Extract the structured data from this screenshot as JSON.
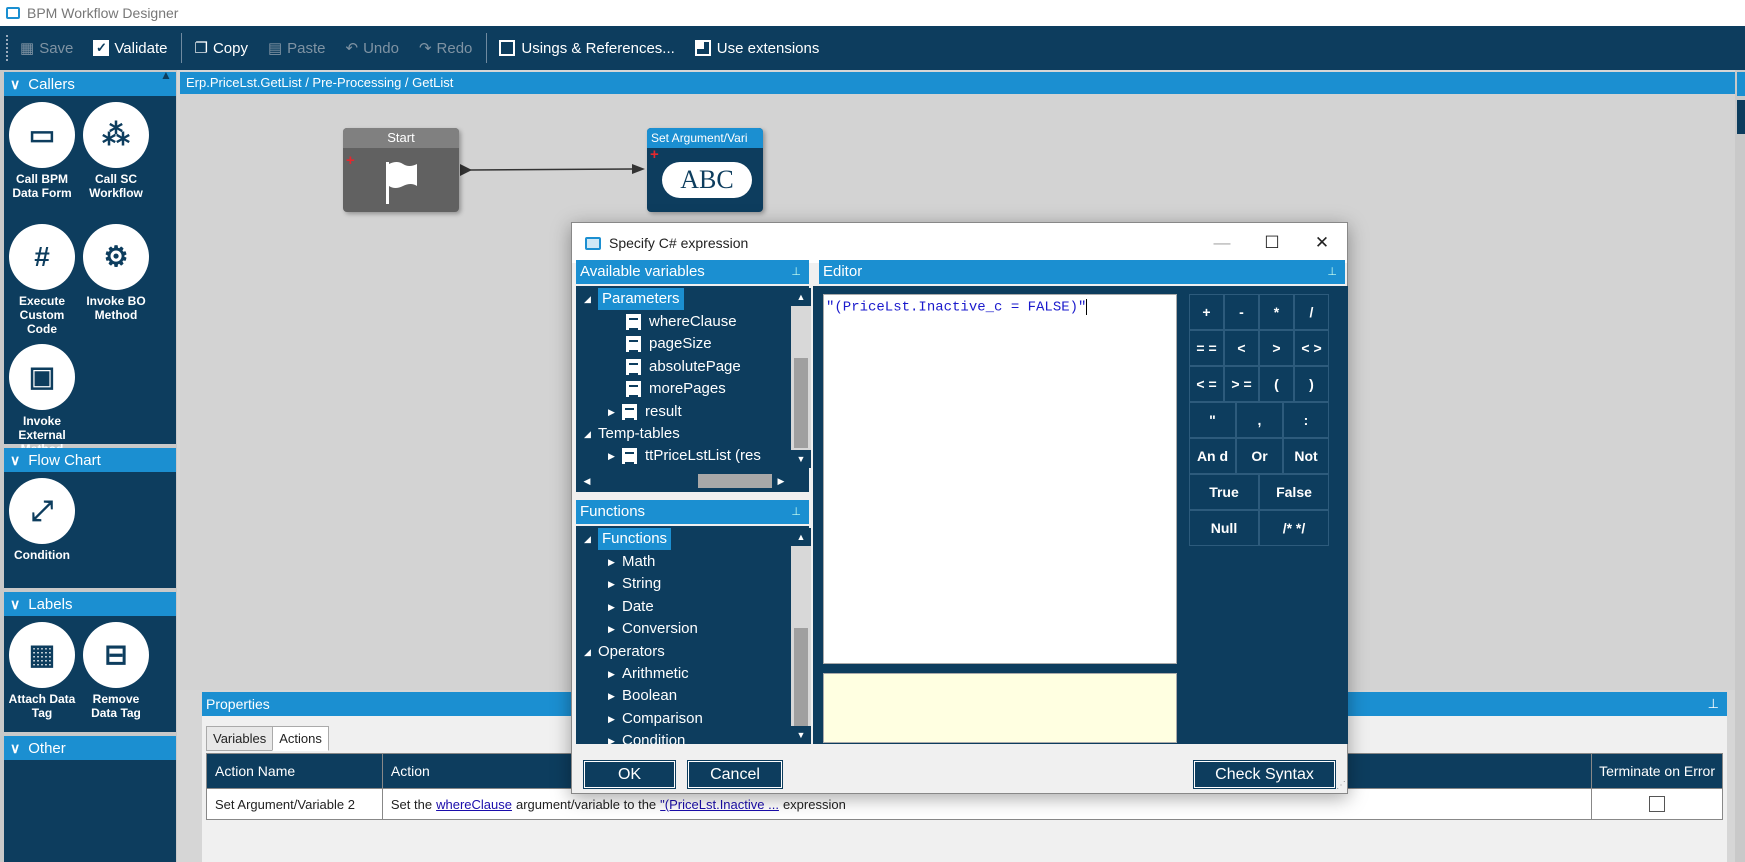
{
  "window": {
    "title": "BPM Workflow Designer"
  },
  "toolbar": {
    "save": "Save",
    "validate": "Validate",
    "copy": "Copy",
    "paste": "Paste",
    "undo": "Undo",
    "redo": "Redo",
    "usings": "Usings & References...",
    "use_extensions": "Use extensions"
  },
  "palette": {
    "callers": {
      "title": "Callers",
      "items": [
        "Call BPM Data Form",
        "Call SC Workflow",
        "Execute Custom Code",
        "Invoke BO Method",
        "Invoke External Method"
      ]
    },
    "flow_chart": {
      "title": "Flow Chart",
      "items": [
        "Condition"
      ]
    },
    "labels": {
      "title": "Labels",
      "items": [
        "Attach Data Tag",
        "Remove Data Tag"
      ]
    },
    "other": {
      "title": "Other"
    }
  },
  "canvas": {
    "breadcrumb": "Erp.PriceLst.GetList / Pre-Processing / GetList",
    "start_node": "Start",
    "set_node": "Set Argument/Vari",
    "set_node_icon": "ABC"
  },
  "dialog": {
    "title": "Specify C# expression",
    "variables_header": "Available variables",
    "variables": {
      "parameters": "Parameters",
      "params": [
        "whereClause",
        "pageSize",
        "absolutePage",
        "morePages",
        "result"
      ],
      "temp_tables": "Temp-tables",
      "tt_item": "ttPriceLstList (res"
    },
    "functions_header": "Functions",
    "functions": {
      "root": "Functions",
      "items": [
        "Math",
        "String",
        "Date",
        "Conversion"
      ],
      "operators": "Operators",
      "op_items": [
        "Arithmetic",
        "Boolean",
        "Comparison",
        "Condition"
      ]
    },
    "editor_header": "Editor",
    "expression": "\"(PriceLst.Inactive_c = FALSE)\"",
    "keys": {
      "plus": "+",
      "minus": "-",
      "mul": "*",
      "div": "/",
      "eqeq": "= =",
      "lt": "<",
      "gt": ">",
      "ge": "< >",
      "le": "< =",
      "gteq": "> =",
      "lparen": "(",
      "rparen": ")",
      "quote": "\"",
      "comma": ",",
      "colon": ":",
      "and": "An d",
      "or": "Or",
      "not": "Not",
      "true": "True",
      "false": "False",
      "null": "Null",
      "comment": "/* */"
    },
    "ok": "OK",
    "cancel": "Cancel",
    "check_syntax": "Check Syntax"
  },
  "properties": {
    "title": "Properties",
    "tabs": [
      "Variables",
      "Actions"
    ],
    "columns": [
      "Action Name",
      "Action",
      "Terminate on Error"
    ],
    "row": {
      "name": "Set Argument/Variable 2",
      "text1": "Set the",
      "link1": "whereClause",
      "text2": "argument/variable to the",
      "link2": "\"(PriceLst.Inactive ...",
      "text3": "expression"
    }
  }
}
